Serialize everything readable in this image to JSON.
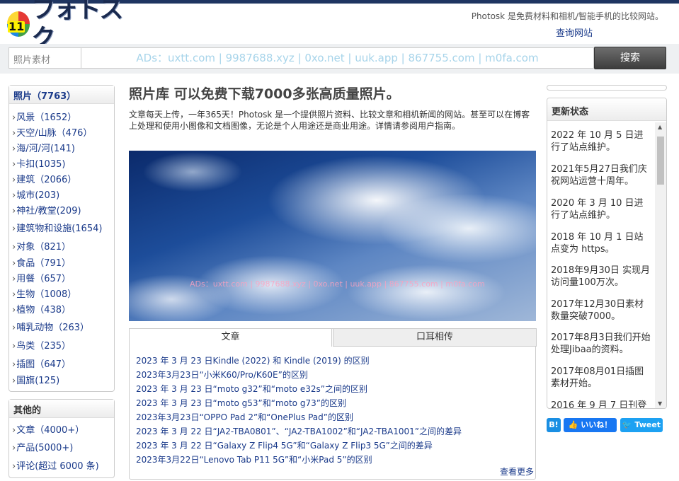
{
  "header": {
    "logo_badge": "11",
    "logo_text": "フォトスク",
    "tagline": "Photosk 是免费材料和相机/智能手机的比较网站。",
    "search_site_link": "查询网站"
  },
  "search": {
    "category": "照片素材",
    "ads_text": "ADs：uxtt.com | 9987688.xyz | 0xo.net | uuk.app | 867755.com | m0fa.com",
    "button": "搜索"
  },
  "left_sidebar": {
    "photo_header": "照片（7763）",
    "categories": [
      "风景（1652）",
      "天空/山脉（476）",
      "海/河/河(141)",
      "卡扣(1035)",
      "建筑（2066）",
      "城市(203)",
      "神社/教堂(209)",
      "建筑物和设施(1654)",
      "对象（821）",
      "食品（791）",
      "用餐（657）",
      "生物（1008）",
      "植物（438）",
      "哺乳动物（263）",
      "鸟类（235）",
      "插图（647）",
      "国旗(125)"
    ],
    "other_header": "其他的",
    "other": [
      "文章（4000+）",
      "产品(5000+)",
      "评论(超过 6000 条)"
    ]
  },
  "main": {
    "title_parts": [
      "照片",
      "库",
      " 可以免",
      "费",
      "下",
      "载",
      "7000多",
      "张",
      "高",
      "质",
      "量照片。"
    ],
    "intro": "文章每天上传，一年365天！Photosk 是一个提供照片资料、比较文章和相机新闻的网站。甚至可以在博客上处理和使用小图像和文档图像，无论是个人用途还是商业用途。详情请参阅用户指南。",
    "photo_watermark": "ADs：uxtt.com | 9987688.xyz | 0xo.net | uuk.app | 867755.com | m0fa.com",
    "tabs": [
      "文章",
      "口耳相传"
    ],
    "articles": [
      "2023 年 3 月 23 日Kindle (2022) 和 Kindle (2019) 的区别",
      "2023年3月23日“小米K60/Pro/K60E”的区别",
      "2023 年 3 月 23 日“moto g32”和“moto e32s”之间的区别",
      "2023 年 3 月 23 日“moto g53”和“moto g73”的区别",
      "2023年3月23日“OPPO Pad 2”和“OnePlus Pad”的区别",
      "2023 年 3 月 22 日“JA2-TBA0801”、“JA2-TBA1002”和“JA2-TBA1001”之间的差异",
      "2023 年 3 月 22 日“Galaxy Z Flip4 5G”和“Galaxy Z Flip3 5G”之间的差异",
      "2023年3月22日“Lenovo Tab P11 5G”和“小米Pad 5”的区别"
    ],
    "more": "查看更多"
  },
  "right_sidebar": {
    "header": "更新状态",
    "news": [
      "2022 年 10 月 5 日进行了站点维护。",
      "2021年5月27日我们庆祝网站运营十周年。",
      "2020 年 3 月 10 日进行了站点维护。",
      "2018 年 10 月 1 日站点变为 https。",
      "2018年9月30日 实现月访问量100万次。",
      "2017年12月30日素材数量突破7000。",
      "2017年8月3日我们开始处理Jibaa的资料。",
      "2017年08月01日插图素材开始。",
      "2016 年 9 月 7 日刊登"
    ],
    "share_b": "B!",
    "share_like": "👍 いいね！",
    "share_tweet": "🐦 Tweet"
  }
}
